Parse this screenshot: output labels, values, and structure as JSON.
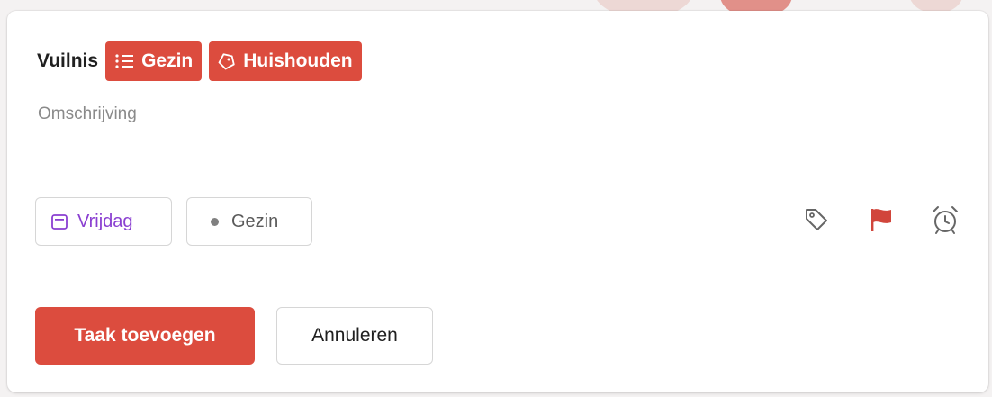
{
  "task": {
    "title": "Vuilnis",
    "chips": [
      {
        "label": "Gezin",
        "icon": "list-icon"
      },
      {
        "label": "Huishouden",
        "icon": "tag-icon"
      }
    ],
    "description_placeholder": "Omschrijving"
  },
  "options": {
    "date_label": "Vrijdag",
    "project_label": "Gezin"
  },
  "actions": {
    "icons": [
      "tag-icon",
      "flag-icon",
      "alarm-clock-icon"
    ]
  },
  "footer": {
    "primary_label": "Taak toevoegen",
    "secondary_label": "Annuleren"
  },
  "colors": {
    "accent": "#dc4c3e",
    "date": "#8a3fd1",
    "muted": "#8a8a8a"
  }
}
